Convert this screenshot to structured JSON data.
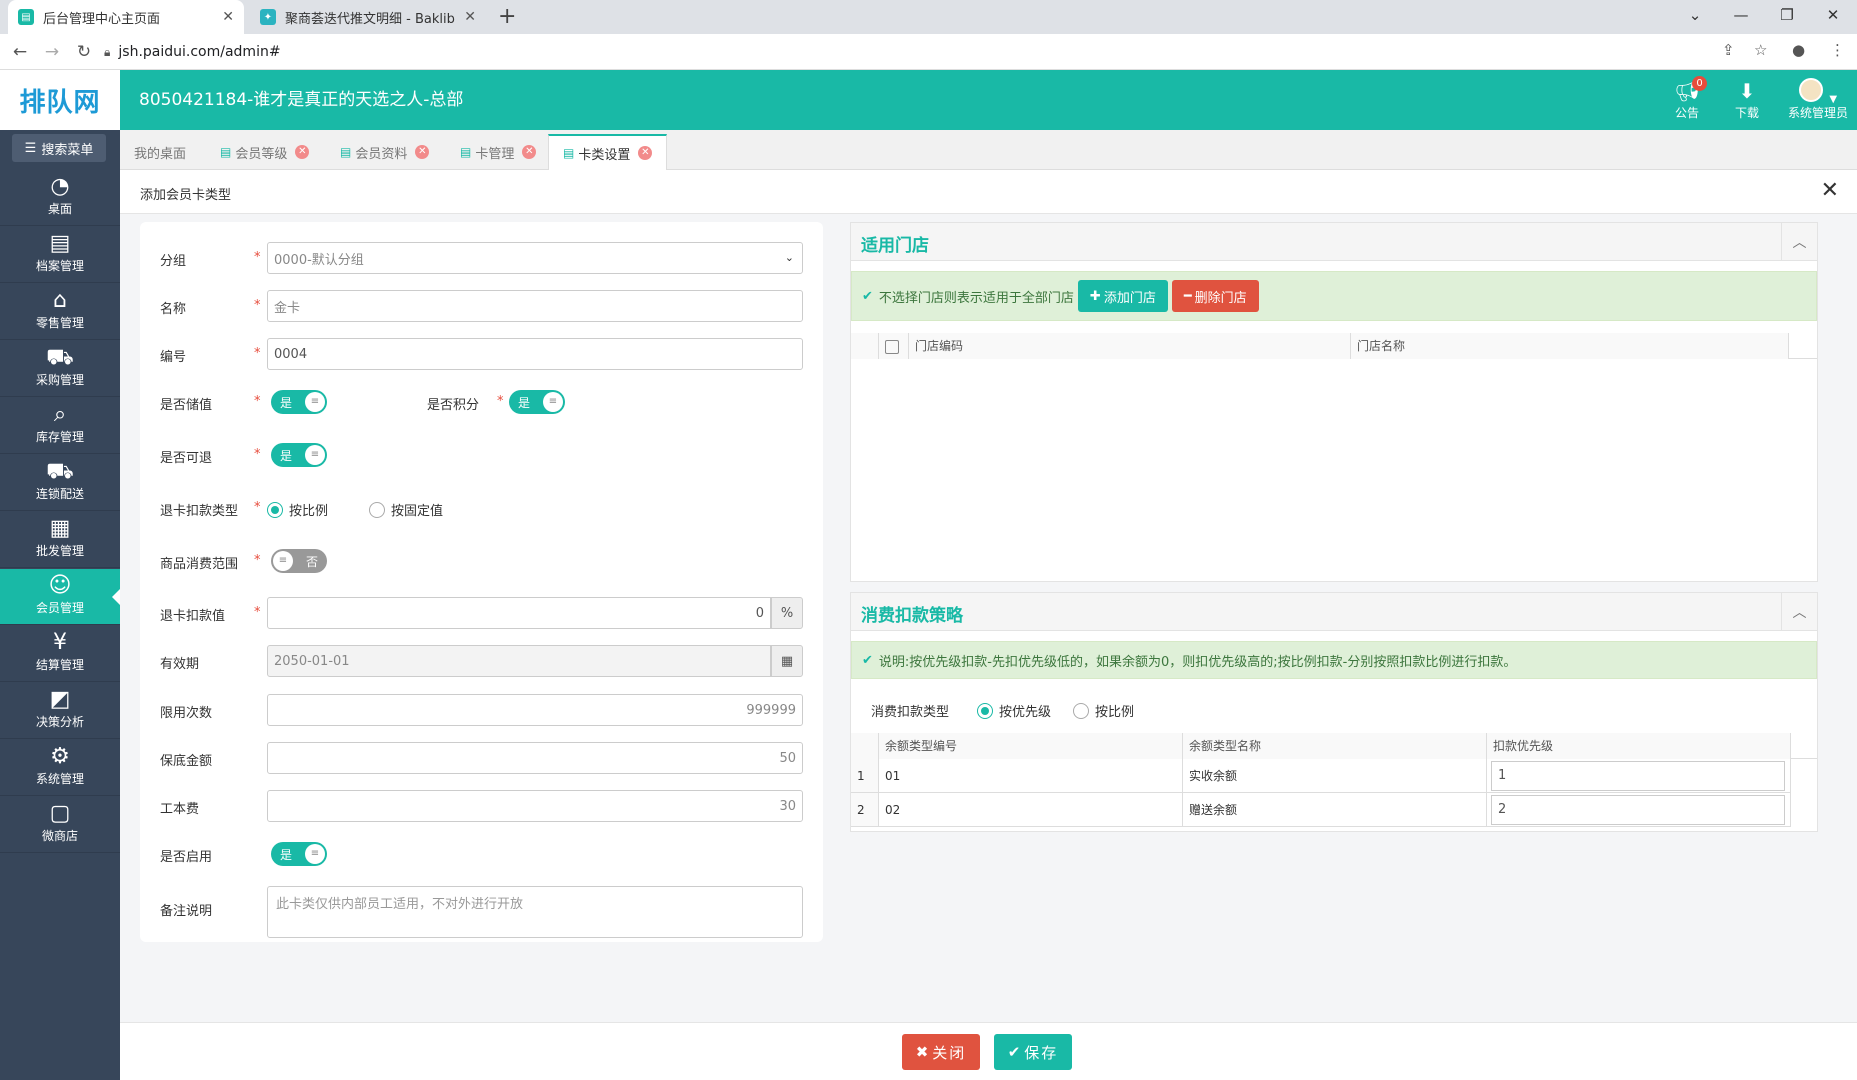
{
  "browser": {
    "tabs": [
      {
        "title": "后台管理中心主页面",
        "close": "✕"
      },
      {
        "title": "聚商荟迭代推文明细 - Baklib",
        "close": "✕"
      }
    ],
    "new_tab": "+",
    "url": "jsh.paidui.com/admin#"
  },
  "header": {
    "logo": "排队网",
    "title": "8050421184-谁才是真正的天选之人-总部",
    "notice_label": "公告",
    "notice_count": "0",
    "download_label": "下载",
    "user_label": "系统管理员"
  },
  "sidebar": {
    "search_label": "搜索菜单",
    "items": [
      {
        "label": "桌面",
        "icon": "dashboard-icon"
      },
      {
        "label": "档案管理",
        "icon": "archive-icon"
      },
      {
        "label": "零售管理",
        "icon": "store-icon"
      },
      {
        "label": "采购管理",
        "icon": "cart-icon"
      },
      {
        "label": "库存管理",
        "icon": "inventory-icon"
      },
      {
        "label": "连锁配送",
        "icon": "truck-icon"
      },
      {
        "label": "批发管理",
        "icon": "wholesale-icon"
      },
      {
        "label": "会员管理",
        "icon": "member-icon"
      },
      {
        "label": "结算管理",
        "icon": "settlement-icon"
      },
      {
        "label": "决策分析",
        "icon": "analysis-icon"
      },
      {
        "label": "系统管理",
        "icon": "settings-icon"
      },
      {
        "label": "微商店",
        "icon": "shop-icon"
      }
    ]
  },
  "page_tabs": [
    {
      "label": "我的桌面"
    },
    {
      "label": "会员等级"
    },
    {
      "label": "会员资料"
    },
    {
      "label": "卡管理"
    },
    {
      "label": "卡类设置"
    }
  ],
  "dialog": {
    "title": "添加会员卡类型",
    "close": "✕"
  },
  "form": {
    "group_label": "分组",
    "group_value": "0000-默认分组",
    "name_label": "名称",
    "name_value": "金卡",
    "code_label": "编号",
    "code_value": "0004",
    "stored_label": "是否储值",
    "stored_value": "是",
    "points_label": "是否积分",
    "points_value": "是",
    "refundable_label": "是否可退",
    "refundable_value": "是",
    "refund_type_label": "退卡扣款类型",
    "refund_type_options": [
      "按比例",
      "按固定值"
    ],
    "scope_label": "商品消费范围",
    "scope_value": "否",
    "refund_value_label": "退卡扣款值",
    "refund_value": "0",
    "refund_unit": "%",
    "expiry_label": "有效期",
    "expiry_value": "2050-01-01",
    "limit_label": "限用次数",
    "limit_value": "999999",
    "min_amount_label": "保底金额",
    "min_amount_value": "50",
    "fee_label": "工本费",
    "fee_value": "30",
    "enabled_label": "是否启用",
    "enabled_value": "是",
    "remark_label": "备注说明",
    "remark_placeholder": "此卡类仅供内部员工适用，不对外进行开放"
  },
  "stores_panel": {
    "title": "适用门店",
    "notice": "不选择门店则表示适用于全部门店",
    "add_button": "添加门店",
    "delete_button": "删除门店",
    "columns": [
      "门店编码",
      "门店名称"
    ]
  },
  "deduct_panel": {
    "title": "消费扣款策略",
    "notice": "说明:按优先级扣款-先扣优先级低的，如果余额为0，则扣优先级高的;按比例扣款-分别按照扣款比例进行扣款。",
    "type_label": "消费扣款类型",
    "type_options": [
      "按优先级",
      "按比例"
    ],
    "columns": [
      "余额类型编号",
      "余额类型名称",
      "扣款优先级"
    ],
    "rows": [
      {
        "no": "1",
        "code": "01",
        "name": "实收余额",
        "priority": "1"
      },
      {
        "no": "2",
        "code": "02",
        "name": "赠送余额",
        "priority": "2"
      }
    ]
  },
  "footer": {
    "close_button": "关闭",
    "save_button": "保存"
  },
  "colors": {
    "accent": "#19b9a6",
    "danger": "#e0533f",
    "sidebar": "#37465a"
  }
}
